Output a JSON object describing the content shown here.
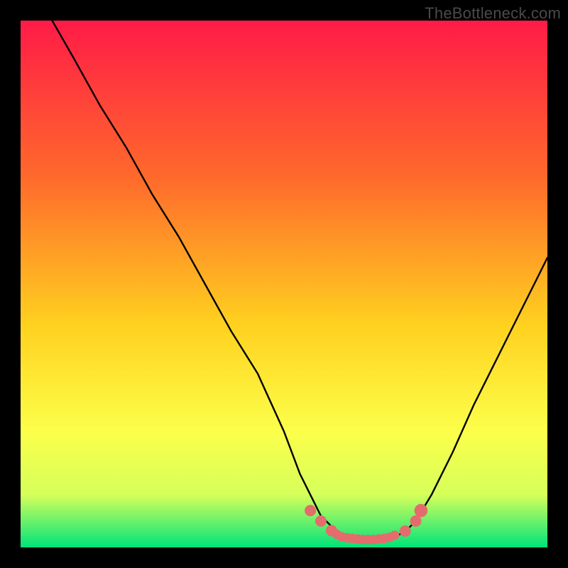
{
  "watermark": "TheBottleneck.com",
  "colors": {
    "frame_black": "#000000",
    "gradient_top": "#ff1b47",
    "gradient_mid1": "#ff6a2b",
    "gradient_mid2": "#ffd21f",
    "gradient_mid3": "#fcff4a",
    "gradient_mid4": "#d6ff5a",
    "gradient_bot": "#00e37a",
    "curve": "#000000",
    "marker": "#e46c6c"
  },
  "chart_data": {
    "type": "line",
    "title": "",
    "xlabel": "",
    "ylabel": "",
    "xlim": [
      0,
      100
    ],
    "ylim": [
      0,
      100
    ],
    "grid": false,
    "legend": false,
    "series": [
      {
        "name": "curve",
        "x": [
          6,
          10,
          15,
          20,
          25,
          30,
          35,
          40,
          45,
          50,
          53,
          55,
          57,
          60,
          63,
          66,
          69,
          71,
          73,
          75,
          78,
          82,
          86,
          90,
          94,
          98,
          100
        ],
        "y": [
          100,
          93,
          84,
          76,
          67,
          59,
          50,
          41,
          33,
          22,
          14,
          10,
          6,
          3,
          2,
          1.5,
          1.5,
          2,
          3,
          5,
          10,
          18,
          27,
          35,
          43,
          51,
          55
        ]
      }
    ],
    "markers": [
      {
        "x": 55,
        "y": 7,
        "r": 1.2
      },
      {
        "x": 57,
        "y": 5,
        "r": 1.2
      },
      {
        "x": 59,
        "y": 3.2,
        "r": 1.2
      },
      {
        "x": 60,
        "y": 2.5,
        "r": 1.0
      },
      {
        "x": 61,
        "y": 2.0,
        "r": 1.0
      },
      {
        "x": 62,
        "y": 1.8,
        "r": 1.0
      },
      {
        "x": 63,
        "y": 1.7,
        "r": 1.0
      },
      {
        "x": 64,
        "y": 1.6,
        "r": 1.0
      },
      {
        "x": 65,
        "y": 1.5,
        "r": 1.0
      },
      {
        "x": 66,
        "y": 1.5,
        "r": 1.0
      },
      {
        "x": 67,
        "y": 1.5,
        "r": 1.0
      },
      {
        "x": 68,
        "y": 1.6,
        "r": 1.0
      },
      {
        "x": 69,
        "y": 1.7,
        "r": 1.0
      },
      {
        "x": 70,
        "y": 1.9,
        "r": 1.0
      },
      {
        "x": 71,
        "y": 2.3,
        "r": 1.0
      },
      {
        "x": 73,
        "y": 3.1,
        "r": 1.2
      },
      {
        "x": 75,
        "y": 5.0,
        "r": 1.2
      },
      {
        "x": 76,
        "y": 7.0,
        "r": 1.4
      }
    ],
    "annotation": "V-shaped bottleneck curve over a red-to-green vertical gradient. Minimum (optimal, green zone) around x≈66. Pink markers highlight the near-optimal region roughly x∈[55,76]."
  }
}
